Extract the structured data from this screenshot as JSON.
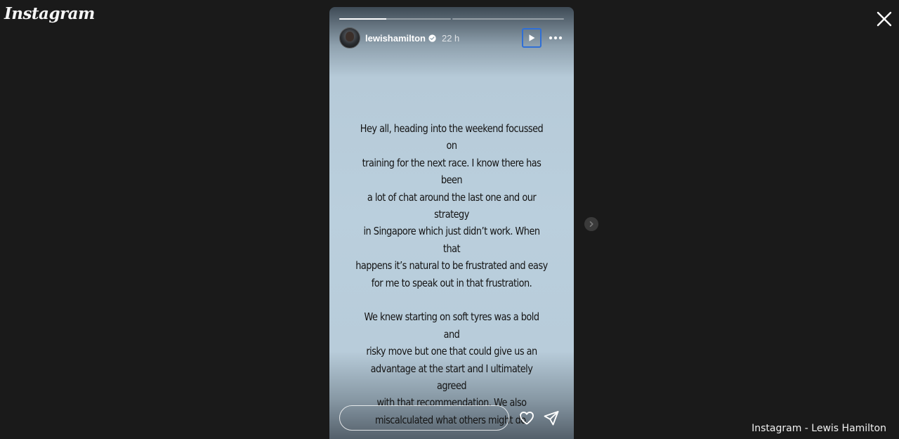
{
  "app": {
    "logo_text": "Instagram"
  },
  "story": {
    "progress": [
      {
        "segment": 1,
        "filled_fraction": 0.42
      },
      {
        "segment": 2,
        "filled_fraction": 0
      }
    ],
    "user": {
      "username": "lewishamilton",
      "verified": true,
      "posted_ago": "22 h"
    },
    "paragraphs": [
      "Hey all, heading into the weekend focussed on\ntraining for the next race. I know there has been\na lot of chat around the last one and our strategy\nin Singapore which just didn’t work. When that\nhappens it’s natural to be frustrated and easy\nfor me to speak out in that frustration.",
      "We knew starting on soft tyres was a bold and\nrisky move but one that could give us an\nadvantage at the start and I ultimately agreed\nwith that recommendation. We also\nmiscalculated what others might do."
    ],
    "reply": {
      "value": "",
      "placeholder": ""
    }
  },
  "icons": {
    "close": "close-icon",
    "play": "play-icon",
    "more": "more-horizontal-icon",
    "like": "heart-icon",
    "share": "send-icon",
    "next": "chevron-right-icon",
    "verified": "verified-badge-icon"
  },
  "colors": {
    "background": "#1a1a1a",
    "focus_outline": "#2f6fd6",
    "story_bg": "#bacfdd"
  },
  "caption": {
    "text": "Instagram - Lewis Hamilton"
  }
}
